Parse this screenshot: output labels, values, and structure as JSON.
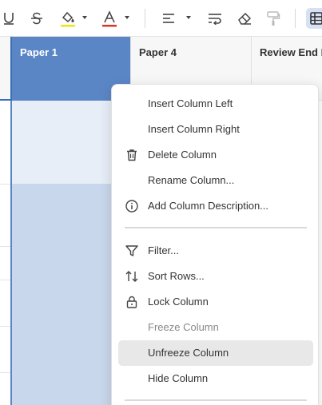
{
  "toolbar": {
    "icons": [
      "underline-icon",
      "strikethrough-icon",
      "fill-color-icon",
      "text-color-icon",
      "align-left-icon",
      "text-wrap-icon",
      "eraser-icon",
      "format-painter-icon",
      "table-view-icon"
    ],
    "fill_color": "#f2e40c",
    "text_color": "#d9342b"
  },
  "columns": [
    {
      "label": "Paper 1",
      "selected": true
    },
    {
      "label": "Paper 4",
      "selected": false
    },
    {
      "label": "Review End D",
      "selected": false
    }
  ],
  "menu": {
    "items": [
      {
        "label": "Insert Column Left",
        "icon": ""
      },
      {
        "label": "Insert Column Right",
        "icon": ""
      },
      {
        "label": "Delete Column",
        "icon": "trash-icon"
      },
      {
        "label": "Rename Column...",
        "icon": ""
      },
      {
        "label": "Add Column Description...",
        "icon": "info-icon"
      },
      {
        "label": "Filter...",
        "icon": "filter-icon"
      },
      {
        "label": "Sort Rows...",
        "icon": "sort-icon"
      },
      {
        "label": "Lock Column",
        "icon": "lock-icon"
      },
      {
        "label": "Freeze Column",
        "icon": "",
        "disabled": true
      },
      {
        "label": "Unfreeze Column",
        "icon": "",
        "highlighted": true
      },
      {
        "label": "Hide Column",
        "icon": ""
      }
    ]
  },
  "colors": {
    "selected_header": "#5b86c6",
    "selected_cell": "#c9d7ec",
    "highlight": "#e8e8e8"
  }
}
